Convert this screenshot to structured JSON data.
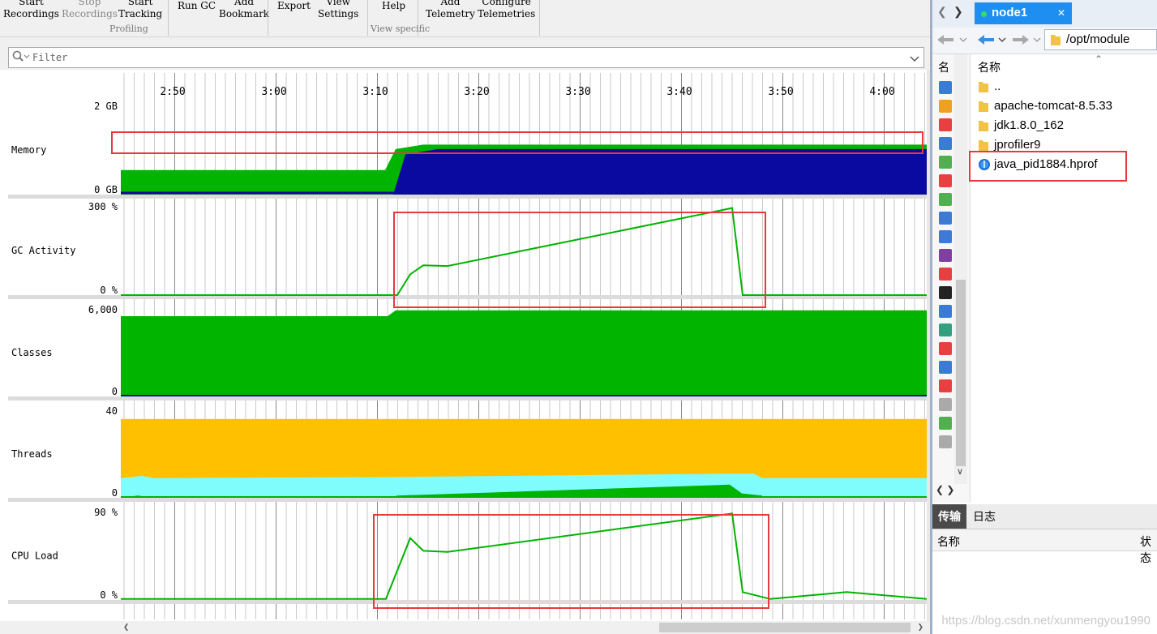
{
  "toolbar": {
    "buttons": [
      {
        "line1": "Start",
        "line2": "Recordings"
      },
      {
        "line1": "Stop",
        "line2": "Recordings"
      },
      {
        "line1": "Start",
        "line2": "Tracking"
      },
      {
        "line1": "Run GC",
        "line2": ""
      },
      {
        "line1": "Add",
        "line2": "Bookmark"
      },
      {
        "line1": "Export",
        "line2": ""
      },
      {
        "line1": "View",
        "line2": "Settings"
      },
      {
        "line1": "Help",
        "line2": ""
      },
      {
        "line1": "Add",
        "line2": "Telemetry"
      },
      {
        "line1": "Configure",
        "line2": "Telemetries"
      }
    ],
    "groups": {
      "profiling": "Profiling",
      "view_specific": "View specific"
    }
  },
  "filter": {
    "placeholder": "Filter"
  },
  "time_axis": {
    "ticks": [
      "2:50",
      "3:00",
      "3:10",
      "3:20",
      "3:30",
      "3:40",
      "3:50",
      "4:00"
    ]
  },
  "telemetries": {
    "memory": {
      "label": "Memory",
      "ymax": "2 GB",
      "ymin": "0 GB"
    },
    "gc": {
      "label": "GC Activity",
      "ymax": "300 %",
      "ymin": "0 %"
    },
    "classes": {
      "label": "Classes",
      "ymax": "6,000",
      "ymin": "0"
    },
    "threads": {
      "label": "Threads",
      "ymax": "40",
      "ymin": "0"
    },
    "cpu": {
      "label": "CPU Load",
      "ymax": "90 %",
      "ymin": "0 %"
    }
  },
  "chart_data": [
    {
      "type": "area",
      "title": "Memory",
      "x_ticks": [
        "2:50",
        "3:00",
        "3:10",
        "3:20",
        "3:30",
        "3:40",
        "3:50",
        "4:00"
      ],
      "x": [
        2.8,
        3.1,
        3.2,
        3.27,
        3.3,
        4.1
      ],
      "series": [
        {
          "values_gb": [
            0.0,
            0.0,
            0.9,
            1.02,
            1.02,
            1.02
          ],
          "color": "#0a0aa0"
        },
        {
          "values_gb": [
            0.55,
            0.55,
            1.02,
            1.12,
            1.12,
            1.12
          ],
          "color": "#00b400"
        }
      ],
      "ylim": [
        "0 GB",
        "2 GB"
      ]
    },
    {
      "type": "line",
      "title": "GC Activity",
      "x_ticks": [
        "2:50",
        "3:00",
        "3:10",
        "3:20",
        "3:30",
        "3:40",
        "3:50",
        "4:00"
      ],
      "points_pct": [
        0,
        0,
        0,
        70,
        100,
        98,
        293,
        0,
        0
      ],
      "ylim": [
        "0 %",
        "300 %"
      ]
    },
    {
      "type": "area",
      "title": "Classes",
      "x_ticks": [
        "2:50",
        "3:00",
        "3:10",
        "3:20",
        "3:30",
        "3:40",
        "3:50",
        "4:00"
      ],
      "values": [
        5500,
        5500,
        5900,
        5900
      ],
      "ylim": [
        "0",
        "6,000"
      ]
    },
    {
      "type": "area",
      "title": "Threads",
      "x_ticks": [
        "2:50",
        "3:00",
        "3:10",
        "3:20",
        "3:30",
        "3:40",
        "3:50",
        "4:00"
      ],
      "series": [
        {
          "values": [
            36,
            36,
            36
          ],
          "color": "#ffc000"
        },
        {
          "values": [
            9,
            9,
            11,
            9
          ],
          "color": "#7ffdfd"
        },
        {
          "values": [
            1,
            1,
            6,
            1
          ],
          "color": "#00b400"
        }
      ],
      "ylim": [
        "0",
        "40"
      ]
    },
    {
      "type": "line",
      "title": "CPU Load",
      "x_ticks": [
        "2:50",
        "3:00",
        "3:10",
        "3:20",
        "3:30",
        "3:40",
        "3:50",
        "4:00"
      ],
      "points_pct": [
        1,
        1,
        1,
        63,
        50,
        49,
        88,
        8,
        1,
        8,
        1
      ],
      "ylim": [
        "0 %",
        "90 %"
      ]
    }
  ],
  "colors": {
    "memory_used": "#0a0aa0",
    "memory_free": "#00b400",
    "threads_yellow": "#ffc000",
    "threads_cyan": "#7ffdfd",
    "accent_red": "#e8393b",
    "tab_blue": "#1e8ef0"
  },
  "right": {
    "tab": {
      "name": "node1"
    },
    "path": "/opt/module",
    "sidebar_header": "名",
    "list_header": "名称",
    "files": [
      {
        "name": "..",
        "icon": "folder-icon"
      },
      {
        "name": "apache-tomcat-8.5.33",
        "icon": "folder-icon"
      },
      {
        "name": "jdk1.8.0_162",
        "icon": "folder-icon"
      },
      {
        "name": "jprofiler9",
        "icon": "folder-icon"
      },
      {
        "name": "java_pid1884.hprof",
        "icon": "hprof-file-icon"
      }
    ],
    "bottom_tabs": {
      "transfer": "传输",
      "log": "日志"
    },
    "bottom_headers": {
      "name": "名称",
      "status": "状态"
    }
  },
  "watermark": "https://blog.csdn.net/xunmengyou1990"
}
